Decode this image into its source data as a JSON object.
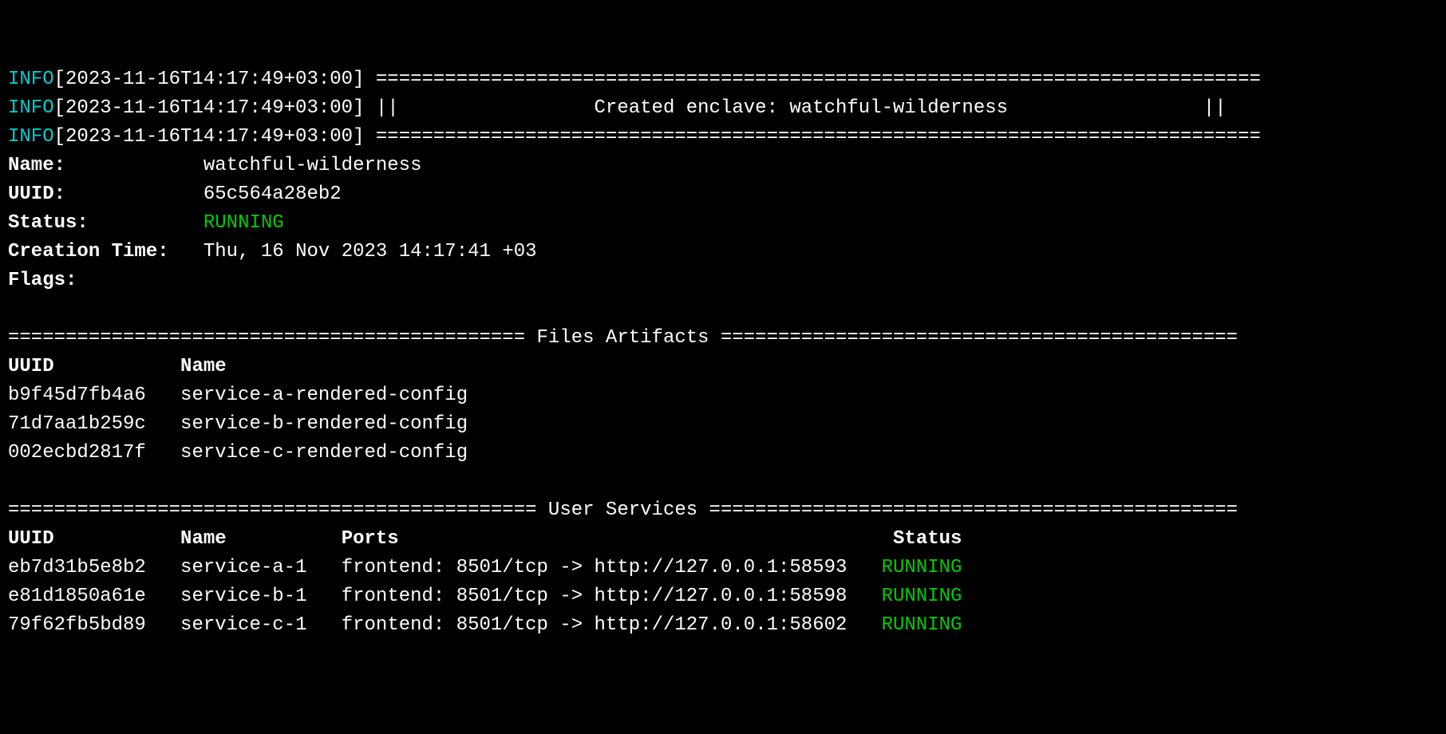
{
  "log": {
    "level": "INFO",
    "ts": "[2023-11-16T14:17:49+03:00]",
    "divider": "=============================================================================",
    "bannerLabel": "Created enclave:",
    "bannerValue": "watchful-wilderness"
  },
  "info": {
    "nameLabel": "Name:",
    "nameValue": "watchful-wilderness",
    "uuidLabel": "UUID:",
    "uuidValue": "65c564a28eb2",
    "statusLabel": "Status:",
    "statusValue": "RUNNING",
    "creationLabel": "Creation Time:",
    "creationValue": "Thu, 16 Nov 2023 14:17:41 +03",
    "flagsLabel": "Flags:",
    "flagsValue": ""
  },
  "artifacts": {
    "title": "Files Artifacts",
    "header": {
      "uuid": "UUID",
      "name": "Name"
    },
    "rows": [
      {
        "uuid": "b9f45d7fb4a6",
        "name": "service-a-rendered-config"
      },
      {
        "uuid": "71d7aa1b259c",
        "name": "service-b-rendered-config"
      },
      {
        "uuid": "002ecbd2817f",
        "name": "service-c-rendered-config"
      }
    ]
  },
  "services": {
    "title": "User Services",
    "header": {
      "uuid": "UUID",
      "name": "Name",
      "ports": "Ports",
      "status": "Status"
    },
    "rows": [
      {
        "uuid": "eb7d31b5e8b2",
        "name": "service-a-1",
        "ports": "frontend: 8501/tcp -> http://127.0.0.1:58593",
        "status": "RUNNING"
      },
      {
        "uuid": "e81d1850a61e",
        "name": "service-b-1",
        "ports": "frontend: 8501/tcp -> http://127.0.0.1:58598",
        "status": "RUNNING"
      },
      {
        "uuid": "79f62fb5bd89",
        "name": "service-c-1",
        "ports": "frontend: 8501/tcp -> http://127.0.0.1:58602",
        "status": "RUNNING"
      }
    ]
  }
}
